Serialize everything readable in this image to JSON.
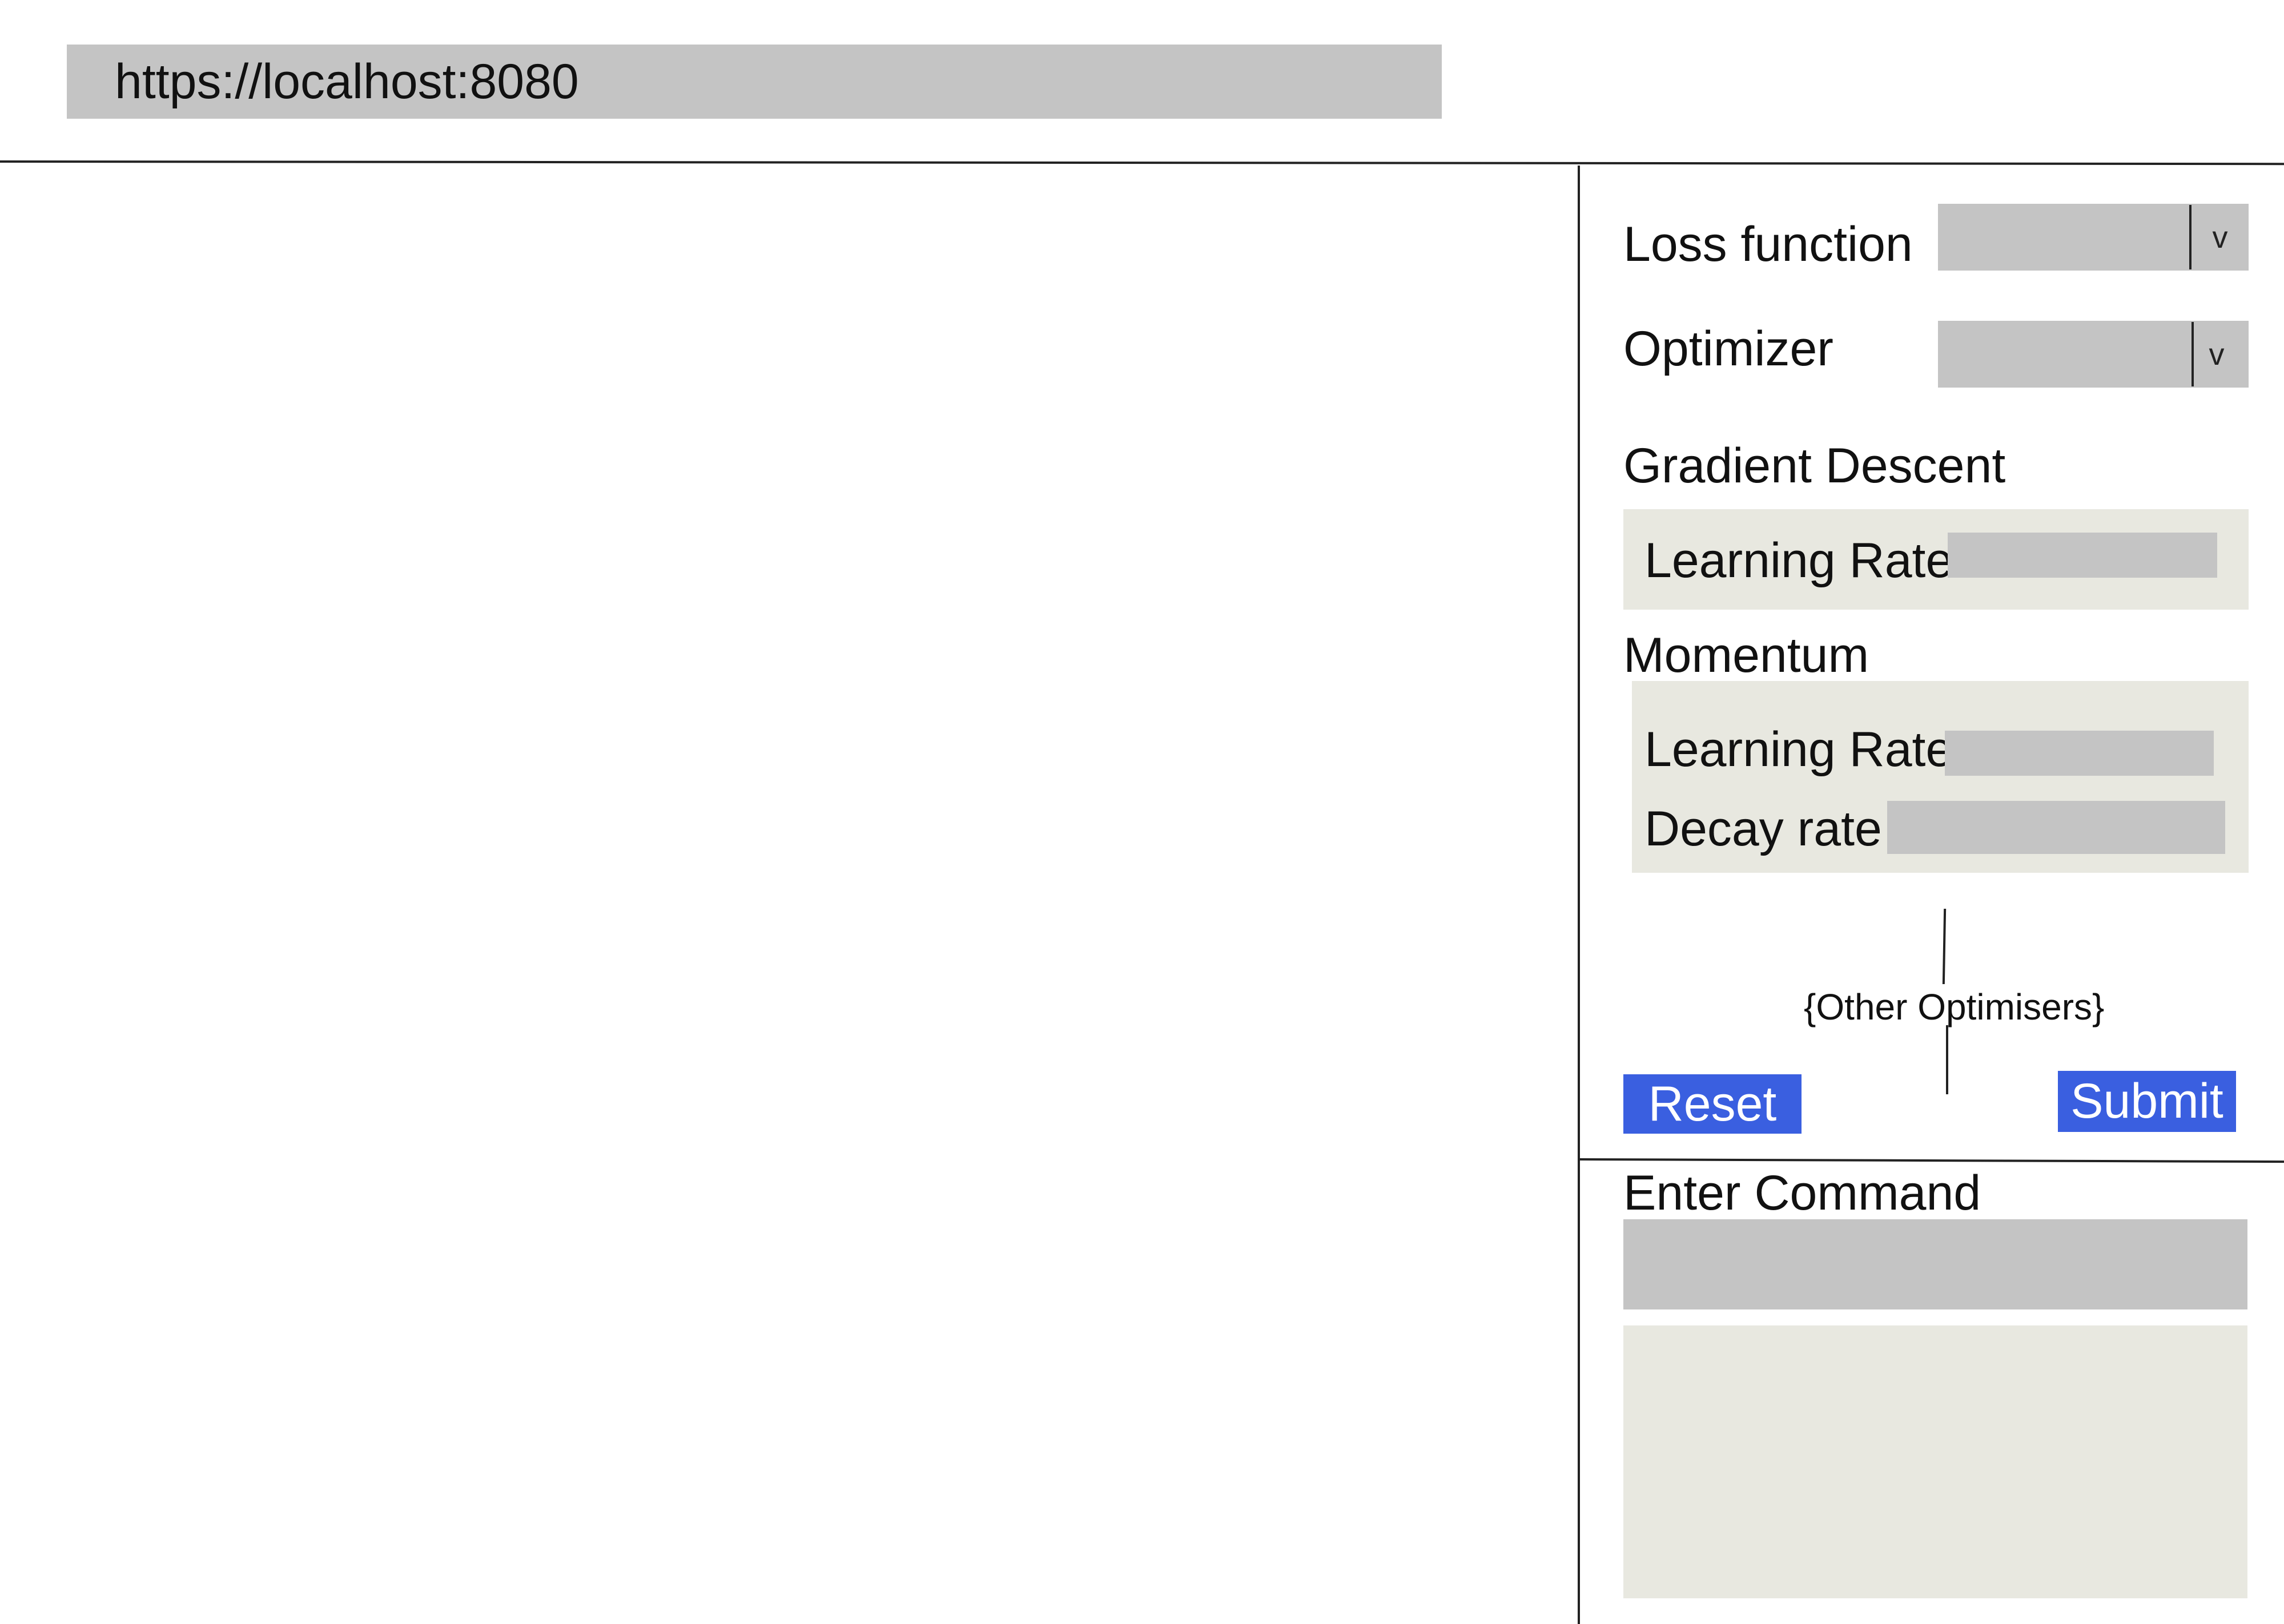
{
  "browser": {
    "url": "https://localhost:8080"
  },
  "settings": {
    "loss_function": {
      "label": "Loss function",
      "selected": "",
      "chevron": "v"
    },
    "optimizer": {
      "label": "Optimizer",
      "selected": "",
      "chevron": "v"
    },
    "gradient_descent": {
      "title": "Gradient Descent",
      "learning_rate_label": "Learning Rate",
      "learning_rate_value": ""
    },
    "momentum": {
      "title": "Momentum",
      "learning_rate_label": "Learning Rate",
      "learning_rate_value": "",
      "decay_rate_label": "Decay rate",
      "decay_rate_value": ""
    },
    "other_optimisers": "{Other Optimisers}",
    "reset_label": "Reset",
    "submit_label": "Submit"
  },
  "command": {
    "label": "Enter Command",
    "input_value": "",
    "output_text": ""
  },
  "colors": {
    "field_gray": "#c4c4c4",
    "group_background": "#e8e8e0",
    "button_blue": "#3a5fe0"
  }
}
